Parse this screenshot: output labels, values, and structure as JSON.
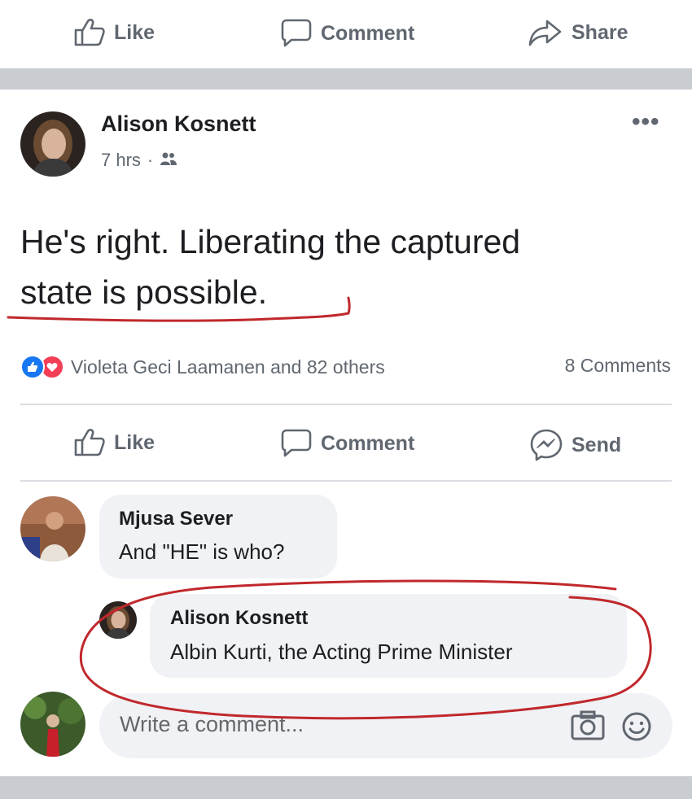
{
  "top_actions": {
    "like_label": "Like",
    "comment_label": "Comment",
    "share_label": "Share"
  },
  "post": {
    "author": "Alison Kosnett",
    "time": "7 hrs",
    "separator": "·",
    "audience_icon": "friends-icon",
    "more_icon": "more-options-icon",
    "more_glyph": "•••",
    "text_line1": "He's right.  Liberating the captured",
    "text_line2": "state is possible.",
    "reactions_text": "Violeta Geci Laamanen and 82 others",
    "comments_count": "8 Comments",
    "actions": {
      "like_label": "Like",
      "comment_label": "Comment",
      "send_label": "Send"
    }
  },
  "comments": [
    {
      "author": "Mjusa Sever",
      "text": "And \"HE\" is who?"
    },
    {
      "author": "Alison Kosnett",
      "text": "Albin Kurti, the Acting Prime Minister"
    }
  ],
  "composer": {
    "placeholder": "Write a comment..."
  },
  "colors": {
    "like_blue": "#1877f2",
    "love_red": "#f33e58",
    "annotation_red": "#c0282c",
    "separator_gray": "#c9ccd1",
    "bubble_gray": "#f0f2f5"
  }
}
